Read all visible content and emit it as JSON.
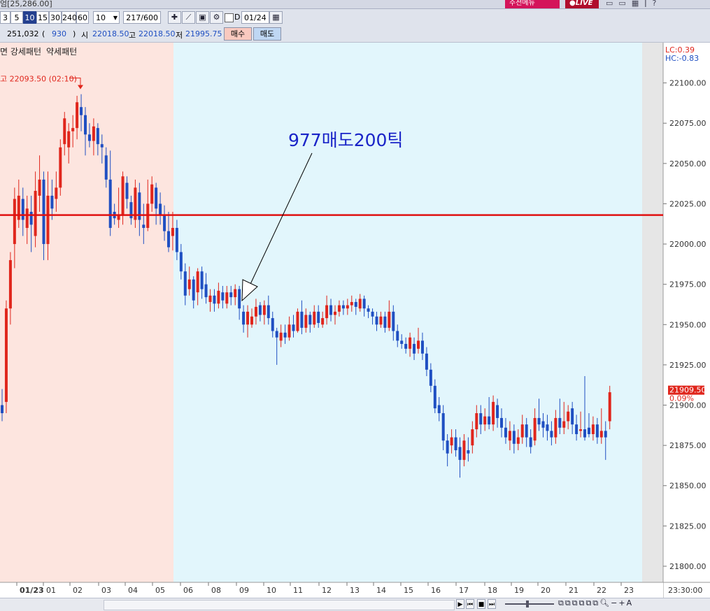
{
  "window": {
    "title": "엄[25,286.00]",
    "badge_left": "주전메뉴",
    "badge_live": "LIVE",
    "icons": [
      "window-icon",
      "restore-icon",
      "layout-icon",
      "pin-icon",
      "help-icon"
    ]
  },
  "toolbar": {
    "periods": [
      "3",
      "5",
      "10",
      "15",
      "30",
      "240",
      "60"
    ],
    "selected_period": "10",
    "interval_value": "10",
    "count_current": "217",
    "count_total": "/600",
    "checkbox_label": "D",
    "date_value": "01/24"
  },
  "infobar": {
    "volume": "251,032",
    "change_open": "(",
    "change": "930",
    "change_close": ")",
    "open_label": "시",
    "open_value": "22018.50",
    "high_label": "고",
    "high_value": "22018.50",
    "low_label": "저",
    "low_value": "21995.75",
    "buy_label": "매수",
    "sell_label": "매도"
  },
  "legend": {
    "left_text": "면 강세패턴",
    "right_text": "약세패턴",
    "lc": "LC:0.39",
    "hc": "HC:-0.83"
  },
  "chart_data": {
    "type": "candlestick",
    "y_ticks": [
      "22100.00",
      "22075.00",
      "22050.00",
      "22025.00",
      "22000.00",
      "21975.00",
      "21950.00",
      "21925.00",
      "21900.00",
      "21875.00",
      "21850.00",
      "21825.00",
      "21800.00"
    ],
    "ylim": [
      21790,
      22125
    ],
    "x_ticks": [
      "01/23",
      "01",
      "02",
      "03",
      "04",
      "05",
      "06",
      "08",
      "09",
      "10",
      "11",
      "12",
      "13",
      "14",
      "15",
      "16",
      "17",
      "18",
      "19",
      "20",
      "21",
      "22",
      "23",
      "23:30:00"
    ],
    "horizontal_line": 22018,
    "high_marker": {
      "label": "고 22093.50 (02:10)",
      "value": 22093.5
    },
    "annotation": {
      "text": "977매도200틱"
    },
    "current_price": "21909.50",
    "current_change": "0.09%",
    "colors": {
      "up": "#e0261c",
      "down": "#1f4fc2",
      "session_bg1": "#fde5df",
      "session_bg2": "#e2f6fc",
      "line": "#e01010",
      "annotation": "#1a24c8"
    },
    "candles": [
      [
        21900,
        21895,
        21910,
        21890
      ],
      [
        21902,
        21960,
        21965,
        21895
      ],
      [
        21960,
        21990,
        21995,
        21950
      ],
      [
        22000,
        22028,
        22035,
        21985
      ],
      [
        22015,
        22030,
        22040,
        22010
      ],
      [
        22028,
        22015,
        22035,
        22005
      ],
      [
        22010,
        22022,
        22030,
        22000
      ],
      [
        22020,
        22012,
        22030,
        21995
      ],
      [
        22005,
        22033,
        22045,
        21998
      ],
      [
        22030,
        22040,
        22055,
        22020
      ],
      [
        22040,
        22000,
        22045,
        21990
      ],
      [
        22000,
        22030,
        22045,
        21990
      ],
      [
        22030,
        22022,
        22040,
        22015
      ],
      [
        22028,
        22035,
        22045,
        22020
      ],
      [
        22035,
        22060,
        22065,
        22030
      ],
      [
        22062,
        22078,
        22082,
        22055
      ],
      [
        22060,
        22070,
        22075,
        22050
      ],
      [
        22070,
        22072,
        22080,
        22060
      ],
      [
        22072,
        22088,
        22092,
        22065
      ],
      [
        22085,
        22080,
        22093,
        22070
      ],
      [
        22080,
        22068,
        22085,
        22055
      ],
      [
        22068,
        22064,
        22075,
        22060
      ],
      [
        22064,
        22073,
        22078,
        22055
      ],
      [
        22072,
        22062,
        22075,
        22055
      ],
      [
        22062,
        22060,
        22068,
        22050
      ],
      [
        22055,
        22040,
        22060,
        22035
      ],
      [
        22040,
        22010,
        22058,
        22005
      ],
      [
        22020,
        22016,
        22025,
        22012
      ],
      [
        22015,
        22018,
        22035,
        22010
      ],
      [
        22018,
        22042,
        22045,
        22012
      ],
      [
        22038,
        22028,
        22042,
        22022
      ],
      [
        22026,
        22016,
        22030,
        22012
      ],
      [
        22015,
        22035,
        22040,
        22010
      ],
      [
        22032,
        22015,
        22038,
        22005
      ],
      [
        22012,
        22010,
        22025,
        22000
      ],
      [
        22010,
        22025,
        22040,
        22008
      ],
      [
        22025,
        22037,
        22042,
        22020
      ],
      [
        22035,
        22022,
        22038,
        22012
      ],
      [
        22025,
        22018,
        22032,
        22012
      ],
      [
        22018,
        22008,
        22024,
        22002
      ],
      [
        22008,
        21998,
        22020,
        21995
      ],
      [
        22005,
        22010,
        22020,
        21996
      ],
      [
        22010,
        21995,
        22015,
        21990
      ],
      [
        21995,
        21983,
        22000,
        21978
      ],
      [
        21983,
        21968,
        21988,
        21962
      ],
      [
        21972,
        21978,
        21986,
        21968
      ],
      [
        21978,
        21965,
        21980,
        21960
      ],
      [
        21970,
        21983,
        21985,
        21962
      ],
      [
        21983,
        21972,
        21986,
        21966
      ],
      [
        21975,
        21967,
        21982,
        21963
      ],
      [
        21964,
        21968,
        21972,
        21958
      ],
      [
        21968,
        21963,
        21972,
        21958
      ],
      [
        21963,
        21971,
        21976,
        21960
      ],
      [
        21970,
        21965,
        21974,
        21960
      ],
      [
        21963,
        21970,
        21974,
        21960
      ],
      [
        21970,
        21967,
        21974,
        21962
      ],
      [
        21967,
        21972,
        21975,
        21962
      ],
      [
        21972,
        21960,
        21974,
        21953
      ],
      [
        21958,
        21950,
        21962,
        21945
      ],
      [
        21950,
        21958,
        21962,
        21942
      ],
      [
        21950,
        21955,
        21960,
        21948
      ],
      [
        21955,
        21961,
        21966,
        21950
      ],
      [
        21962,
        21956,
        21964,
        21952
      ],
      [
        21956,
        21962,
        21965,
        21950
      ],
      [
        21962,
        21954,
        21968,
        21950
      ],
      [
        21954,
        21946,
        21958,
        21942
      ],
      [
        21946,
        21942,
        21948,
        21925
      ],
      [
        21940,
        21945,
        21950,
        21936
      ],
      [
        21945,
        21942,
        21950,
        21938
      ],
      [
        21942,
        21950,
        21955,
        21940
      ],
      [
        21950,
        21946,
        21956,
        21942
      ],
      [
        21946,
        21958,
        21960,
        21945
      ],
      [
        21958,
        21948,
        21965,
        21944
      ],
      [
        21948,
        21956,
        21960,
        21945
      ],
      [
        21956,
        21950,
        21958,
        21945
      ],
      [
        21950,
        21958,
        21962,
        21948
      ],
      [
        21958,
        21951,
        21962,
        21948
      ],
      [
        21950,
        21954,
        21958,
        21948
      ],
      [
        21954,
        21962,
        21968,
        21950
      ],
      [
        21962,
        21956,
        21966,
        21952
      ],
      [
        21956,
        21958,
        21962,
        21950
      ],
      [
        21958,
        21962,
        21965,
        21955
      ],
      [
        21962,
        21960,
        21965,
        21956
      ],
      [
        21960,
        21962,
        21966,
        21956
      ],
      [
        21962,
        21964,
        21968,
        21958
      ],
      [
        21964,
        21961,
        21966,
        21956
      ],
      [
        21960,
        21966,
        21969,
        21958
      ],
      [
        21966,
        21960,
        21968,
        21955
      ],
      [
        21960,
        21958,
        21962,
        21954
      ],
      [
        21958,
        21955,
        21960,
        21950
      ],
      [
        21955,
        21950,
        21958,
        21946
      ],
      [
        21950,
        21955,
        21958,
        21948
      ],
      [
        21955,
        21948,
        21958,
        21945
      ],
      [
        21948,
        21958,
        21965,
        21946
      ],
      [
        21958,
        21946,
        21962,
        21940
      ],
      [
        21946,
        21940,
        21950,
        21936
      ],
      [
        21940,
        21938,
        21944,
        21935
      ],
      [
        21938,
        21935,
        21942,
        21932
      ],
      [
        21935,
        21942,
        21945,
        21930
      ],
      [
        21938,
        21932,
        21942,
        21928
      ],
      [
        21935,
        21940,
        21948,
        21932
      ],
      [
        21940,
        21932,
        21945,
        21928
      ],
      [
        21932,
        21922,
        21936,
        21918
      ],
      [
        21922,
        21912,
        21926,
        21908
      ],
      [
        21912,
        21898,
        21916,
        21895
      ],
      [
        21900,
        21895,
        21905,
        21890
      ],
      [
        21895,
        21878,
        21900,
        21872
      ],
      [
        21878,
        21870,
        21882,
        21862
      ],
      [
        21875,
        21880,
        21885,
        21870
      ],
      [
        21880,
        21872,
        21885,
        21868
      ],
      [
        21874,
        21866,
        21880,
        21855
      ],
      [
        21866,
        21878,
        21882,
        21862
      ],
      [
        21872,
        21870,
        21880,
        21865
      ],
      [
        21875,
        21885,
        21890,
        21870
      ],
      [
        21885,
        21895,
        21900,
        21880
      ],
      [
        21895,
        21888,
        21900,
        21882
      ],
      [
        21888,
        21893,
        21898,
        21884
      ],
      [
        21893,
        21888,
        21905,
        21885
      ],
      [
        21888,
        21902,
        21906,
        21884
      ],
      [
        21900,
        21892,
        21904,
        21886
      ],
      [
        21892,
        21886,
        21898,
        21880
      ],
      [
        21886,
        21880,
        21892,
        21876
      ],
      [
        21878,
        21884,
        21890,
        21872
      ],
      [
        21884,
        21876,
        21888,
        21870
      ],
      [
        21876,
        21880,
        21885,
        21872
      ],
      [
        21880,
        21888,
        21894,
        21876
      ],
      [
        21888,
        21880,
        21892,
        21874
      ],
      [
        21880,
        21874,
        21885,
        21870
      ],
      [
        21878,
        21892,
        21898,
        21875
      ],
      [
        21892,
        21888,
        21904,
        21884
      ],
      [
        21890,
        21886,
        21895,
        21880
      ],
      [
        21888,
        21884,
        21894,
        21878
      ],
      [
        21884,
        21880,
        21890,
        21875
      ],
      [
        21880,
        21892,
        21897,
        21876
      ],
      [
        21892,
        21886,
        21904,
        21882
      ],
      [
        21886,
        21890,
        21902,
        21882
      ],
      [
        21890,
        21896,
        21900,
        21885
      ],
      [
        21898,
        21888,
        21902,
        21882
      ],
      [
        21888,
        21882,
        21894,
        21878
      ],
      [
        21884,
        21885,
        21896,
        21880
      ],
      [
        21885,
        21880,
        21918,
        21878
      ],
      [
        21886,
        21882,
        21895,
        21880
      ],
      [
        21882,
        21888,
        21893,
        21878
      ],
      [
        21888,
        21880,
        21892,
        21876
      ],
      [
        21880,
        21884,
        21898,
        21876
      ],
      [
        21884,
        21880,
        21890,
        21866
      ],
      [
        21890,
        21908,
        21912,
        21885
      ]
    ]
  },
  "statusbar": {
    "icons": [
      "play-icon",
      "prev-icon",
      "stop-icon",
      "next-icon",
      "slider-icon",
      "zoom-out-icon",
      "minus-icon",
      "plus-icon",
      "auto-icon"
    ]
  }
}
